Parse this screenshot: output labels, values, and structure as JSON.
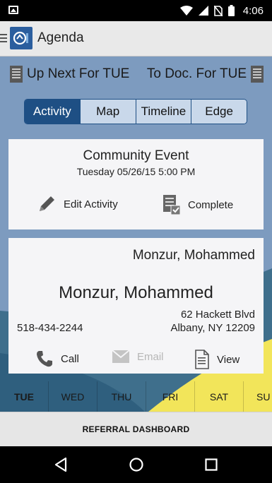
{
  "status_bar": {
    "time": "4:06"
  },
  "app_bar": {
    "title": "Agenda"
  },
  "toolbar": {
    "up_next_label": "Up Next For TUE",
    "to_doc_label": "To Doc. For TUE"
  },
  "tabs": [
    {
      "label": "Activity",
      "active": true
    },
    {
      "label": "Map",
      "active": false
    },
    {
      "label": "Timeline",
      "active": false
    },
    {
      "label": "Edge",
      "active": false
    }
  ],
  "event_card": {
    "title": "Community Event",
    "datetime": "Tuesday 05/26/15 5:00 PM",
    "edit_label": "Edit Activity",
    "complete_label": "Complete"
  },
  "contact_card": {
    "name_header": "Monzur, Mohammed",
    "name": "Monzur, Mohammed",
    "phone": "518-434-2244",
    "address_line1": "62 Hackett Blvd",
    "address_line2": "Albany, NY 12209",
    "call_label": "Call",
    "email_label": "Email",
    "view_label": "View"
  },
  "days": [
    {
      "label": "TUE",
      "selected": true
    },
    {
      "label": "WED",
      "selected": false
    },
    {
      "label": "THU",
      "selected": false
    },
    {
      "label": "FRI",
      "selected": false
    },
    {
      "label": "SAT",
      "selected": false
    },
    {
      "label": "SU",
      "selected": false
    }
  ],
  "footer": {
    "link_label": "REFERRAL DASHBOARD"
  },
  "colors": {
    "accent": "#1e4f84",
    "background_blue": "#7d9bbf",
    "dark_teal": "#3f6f8c",
    "yellow": "#f2e55a"
  }
}
